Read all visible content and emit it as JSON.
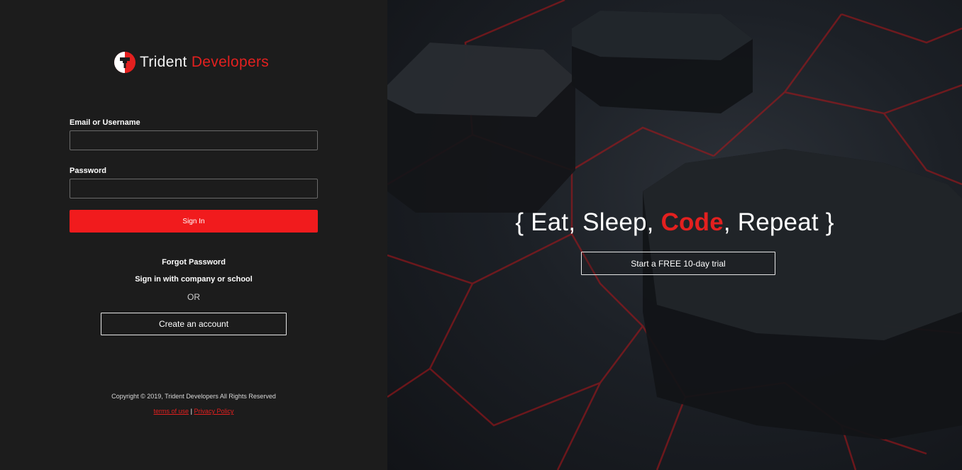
{
  "brand": {
    "name_part1": "Trident",
    "name_part2": "Developers",
    "accent_color": "#e3201f",
    "logo_icon": "trident-helmet-logo"
  },
  "login_form": {
    "email_label": "Email or Username",
    "email_value": "",
    "password_label": "Password",
    "password_value": "",
    "signin_label": "Sign In"
  },
  "links": {
    "forgot_password": "Forgot Password",
    "company_signin": "Sign in with company or school",
    "or_text": "OR",
    "create_account": "Create an account"
  },
  "footer": {
    "copyright": "Copyright © 2019, Trident Developers All Rights Reserved",
    "terms": "terms of use",
    "separator": "|",
    "privacy": "Privacy Policy"
  },
  "hero": {
    "brace_open": "{",
    "part1": "Eat, Sleep,",
    "highlight": "Code",
    "part2": ", Repeat",
    "brace_close": "}",
    "trial_button": "Start a FREE 10-day trial"
  }
}
